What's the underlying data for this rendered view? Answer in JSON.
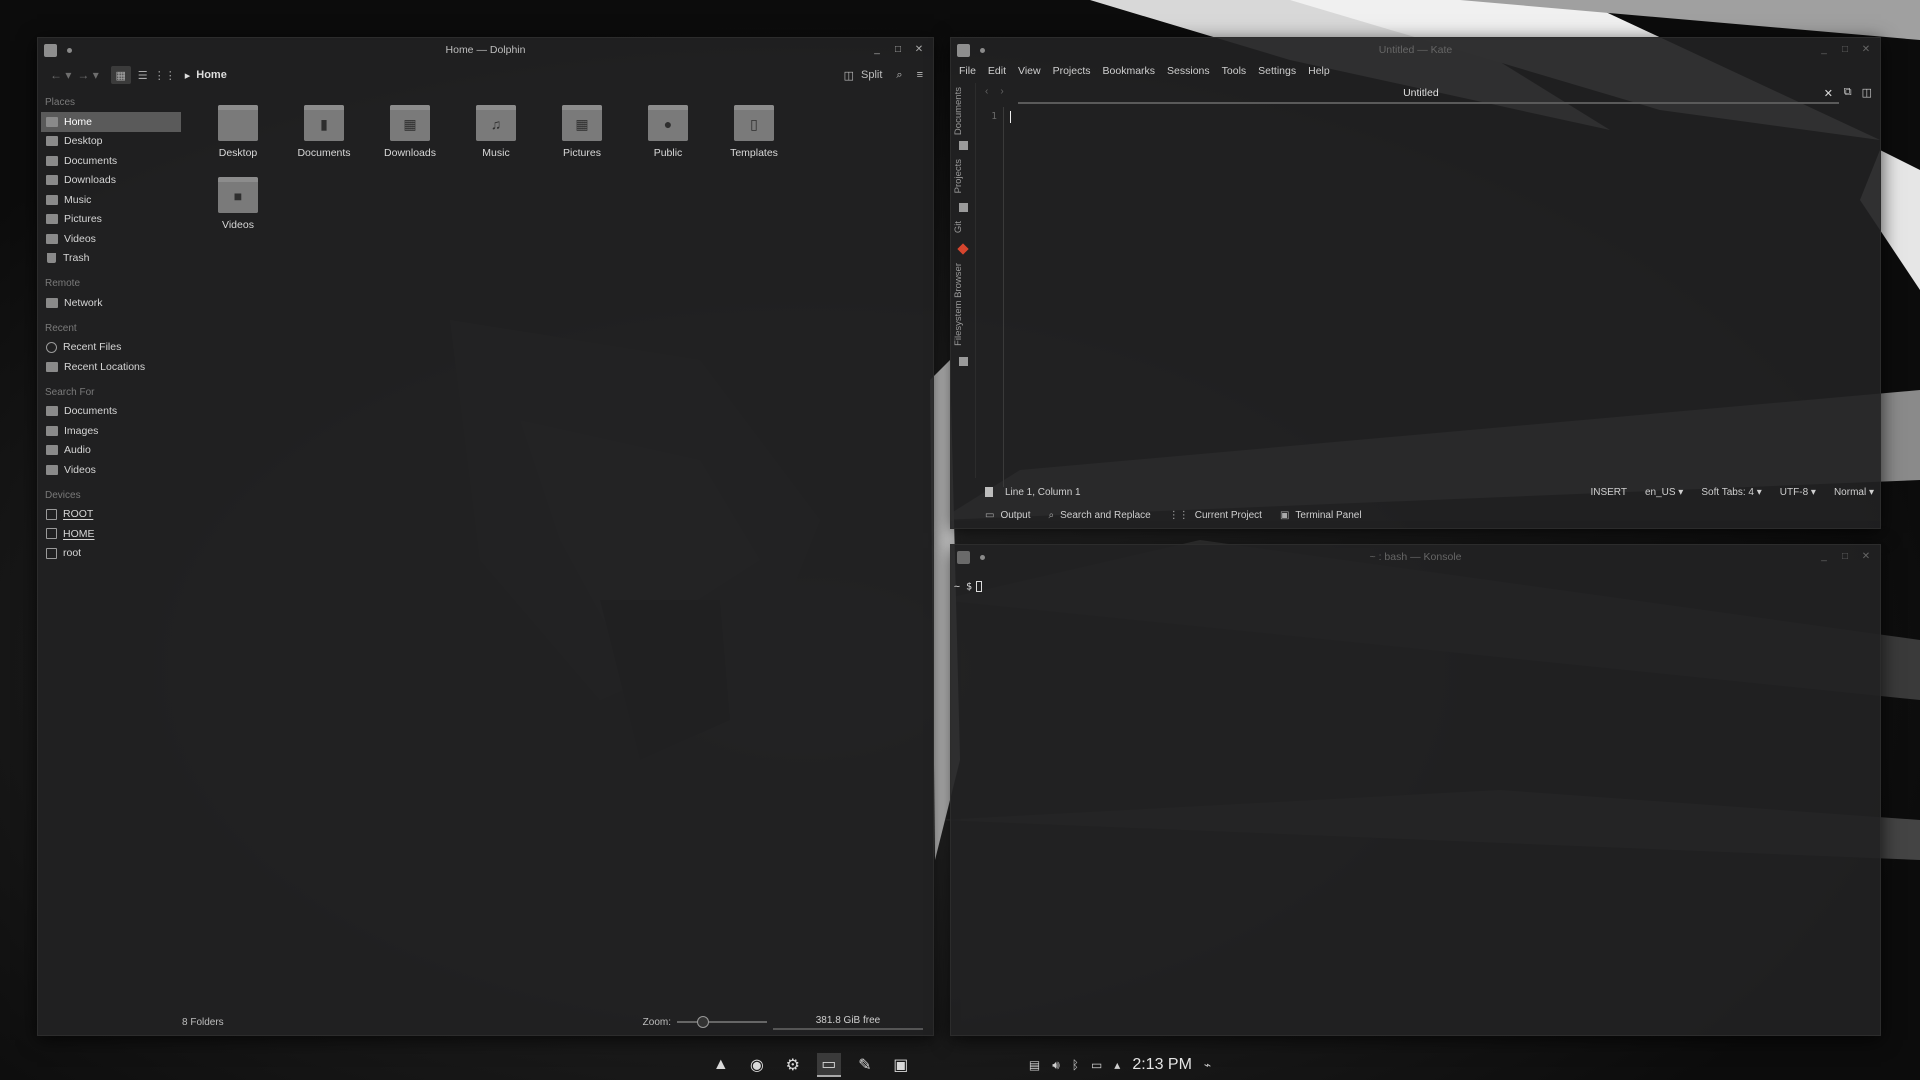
{
  "dolphin": {
    "title": "Home — Dolphin",
    "breadcrumb": "Home",
    "split_label": "Split",
    "sections": [
      {
        "title": "Places",
        "items": [
          {
            "label": "Home",
            "icon": "home-folder-icon",
            "active": true
          },
          {
            "label": "Desktop",
            "icon": "folder-icon"
          },
          {
            "label": "Documents",
            "icon": "folder-icon"
          },
          {
            "label": "Downloads",
            "icon": "folder-icon"
          },
          {
            "label": "Music",
            "icon": "folder-icon"
          },
          {
            "label": "Pictures",
            "icon": "folder-icon"
          },
          {
            "label": "Videos",
            "icon": "folder-icon"
          },
          {
            "label": "Trash",
            "icon": "trash-icon"
          }
        ]
      },
      {
        "title": "Remote",
        "items": [
          {
            "label": "Network",
            "icon": "folder-icon"
          }
        ]
      },
      {
        "title": "Recent",
        "items": [
          {
            "label": "Recent Files",
            "icon": "clock-icon"
          },
          {
            "label": "Recent Locations",
            "icon": "folder-icon"
          }
        ]
      },
      {
        "title": "Search For",
        "items": [
          {
            "label": "Documents",
            "icon": "folder-icon"
          },
          {
            "label": "Images",
            "icon": "folder-icon"
          },
          {
            "label": "Audio",
            "icon": "folder-icon"
          },
          {
            "label": "Videos",
            "icon": "folder-icon"
          }
        ]
      },
      {
        "title": "Devices",
        "items": [
          {
            "label": "ROOT",
            "icon": "drive-icon"
          },
          {
            "label": "HOME",
            "icon": "drive-icon"
          },
          {
            "label": "root",
            "icon": "drive-icon"
          }
        ]
      }
    ],
    "files": [
      {
        "name": "Desktop",
        "glyph": ""
      },
      {
        "name": "Documents",
        "glyph": "▮"
      },
      {
        "name": "Downloads",
        "glyph": "▦"
      },
      {
        "name": "Music",
        "glyph": "♫"
      },
      {
        "name": "Pictures",
        "glyph": "▦"
      },
      {
        "name": "Public",
        "glyph": "●"
      },
      {
        "name": "Templates",
        "glyph": "▯"
      },
      {
        "name": "Videos",
        "glyph": "■"
      }
    ],
    "status_count": "8 Folders",
    "zoom_label": "Zoom:",
    "free_space": "381.8 GiB free"
  },
  "kate": {
    "title": "Untitled — Kate",
    "menu": [
      "File",
      "Edit",
      "View",
      "Projects",
      "Bookmarks",
      "Sessions",
      "Tools",
      "Settings",
      "Help"
    ],
    "side_tabs": [
      "Documents",
      "Projects",
      "Git",
      "Filesystem Browser"
    ],
    "tab_name": "Untitled",
    "line_number": "1",
    "cursor_pos": "Line 1, Column 1",
    "mode": "INSERT",
    "language": "en_US",
    "indent": "Soft Tabs: 4",
    "encoding": "UTF-8",
    "input_mode": "Normal",
    "panels": [
      {
        "label": "Output",
        "icon": "speech-bubble-icon"
      },
      {
        "label": "Search and Replace",
        "icon": "search-icon"
      },
      {
        "label": "Current Project",
        "icon": "grid-icon"
      },
      {
        "label": "Terminal Panel",
        "icon": "terminal-icon"
      }
    ]
  },
  "konsole": {
    "title": "~ : bash — Konsole",
    "prompt": "~ $"
  },
  "taskbar": {
    "apps": [
      "arch-launcher-icon",
      "chromium-icon",
      "steam-icon",
      "dolphin-icon",
      "kate-icon",
      "konsole-icon"
    ],
    "clock": "2:13 PM"
  }
}
